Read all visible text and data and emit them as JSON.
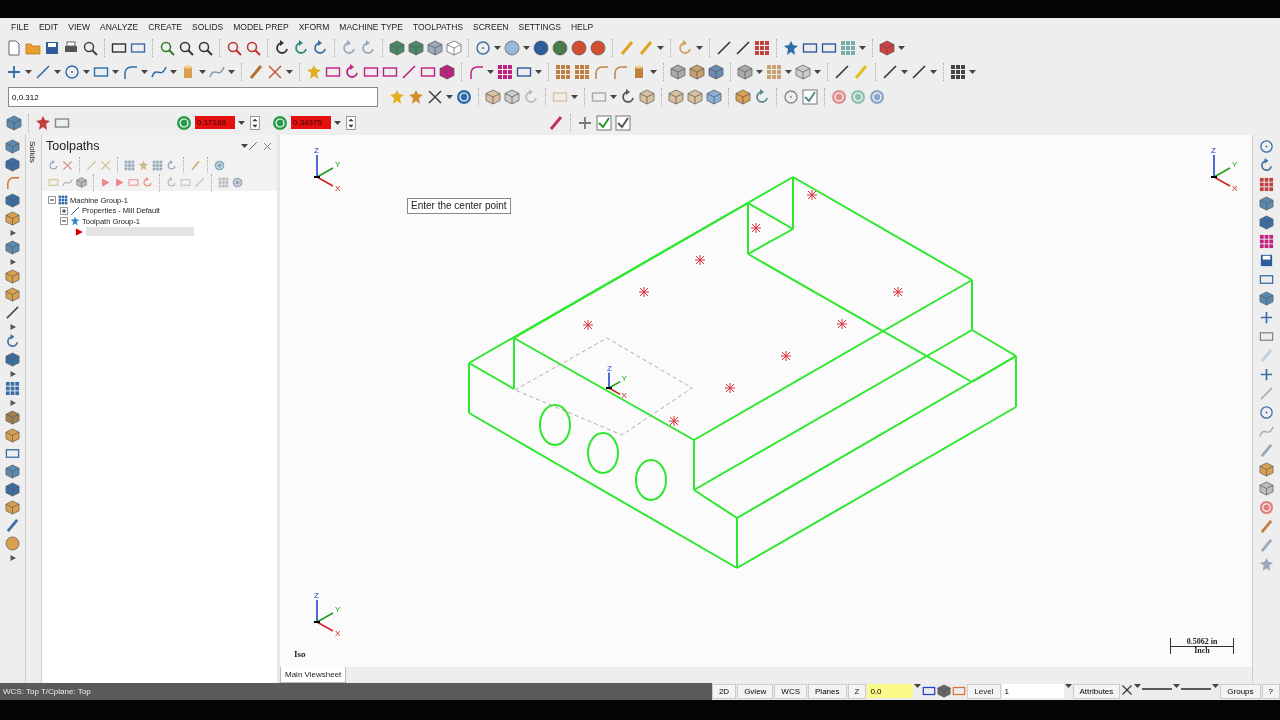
{
  "menu": [
    {
      "label": "FILE"
    },
    {
      "label": "EDIT"
    },
    {
      "label": "VIEW"
    },
    {
      "label": "ANALYZE"
    },
    {
      "label": "CREATE"
    },
    {
      "label": "SOLIDS"
    },
    {
      "label": "MODEL PREP"
    },
    {
      "label": "XFORM"
    },
    {
      "label": "MACHINE TYPE"
    },
    {
      "label": "TOOLPATHS"
    },
    {
      "label": "SCREEN"
    },
    {
      "label": "SETTINGS"
    },
    {
      "label": "HELP"
    }
  ],
  "command_field": {
    "value": "0,0.312"
  },
  "side_tab": {
    "label": "Solids"
  },
  "spin_fields": [
    {
      "value": "0.17188"
    },
    {
      "value": "0.34375"
    }
  ],
  "panel": {
    "title": "Toolpaths",
    "tree": [
      {
        "label": "Machine Group-1",
        "expanded": true,
        "children": [
          {
            "label": "Properties - Mill Default",
            "expanded": false
          },
          {
            "label": "Toolpath Group-1",
            "expanded": true
          }
        ]
      }
    ]
  },
  "viewport": {
    "prompt": "Enter the center point",
    "view_name": "Iso",
    "triads": [
      {
        "x": "X",
        "y": "Y",
        "z": "Z"
      },
      {
        "x": "X",
        "y": "Y",
        "z": "Z"
      },
      {
        "x": "X",
        "y": "Y",
        "z": "Z"
      },
      {
        "x": "X",
        "y": "Y",
        "z": "Z"
      }
    ],
    "scale": {
      "length": "0.5062 in",
      "unit": "Inch"
    }
  },
  "viewsheet_tabs": [
    {
      "label": "Main Viewsheet",
      "selected": true
    }
  ],
  "status_bar": {
    "text": "WCS: Top  T/Cplane: Top",
    "buttons": [
      "2D",
      "Gview",
      "WCS",
      "Planes"
    ],
    "z_label": "Z",
    "z_value": "0.0",
    "level_label": "Level",
    "level_value": "1",
    "attributes": "Attributes",
    "groups": "Groups",
    "help": "?"
  }
}
